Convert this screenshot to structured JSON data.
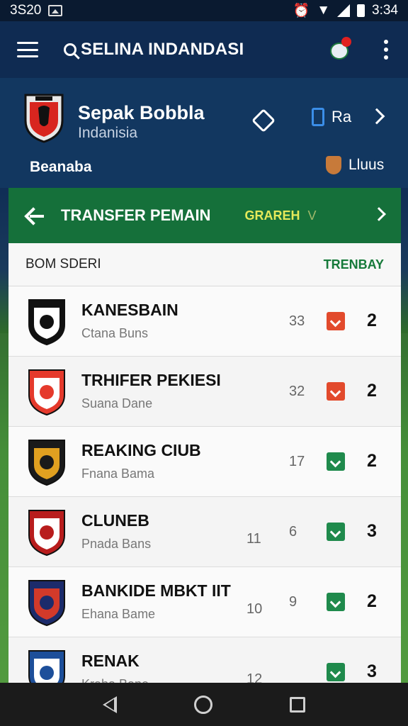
{
  "status_bar": {
    "time_left": "3S20",
    "time_right": "3:34",
    "icons": [
      "image-icon",
      "alarm-icon",
      "wifi-icon",
      "signal-icon",
      "battery-icon"
    ]
  },
  "app_bar": {
    "search_text": "SELINA INDANDASI",
    "icons": [
      "menu-icon",
      "search-icon",
      "globe-icon",
      "more-vert-icon"
    ]
  },
  "league": {
    "title": "Sepak Bobbla",
    "subtitle": "Indanisia",
    "season_label": "Beanaba",
    "lang_label": "Ra",
    "clubs_label": "Lluus"
  },
  "tabs": {
    "transfer": "TRANSFER PEMAIN",
    "grafik": "GRAREH",
    "grafik_suffix": "V"
  },
  "list": {
    "header_left": "BOM SDERI",
    "header_right": "TRENBAY",
    "rows": [
      {
        "title": "KANESBAIN",
        "sub": "Ctana Buns",
        "num1": "",
        "num2": "33",
        "badge": "red",
        "score": "2",
        "crest_colors": [
          "#111111",
          "#ffffff"
        ]
      },
      {
        "title": "TRHIFER PEKIESI",
        "sub": "Suana Dane",
        "num1": "",
        "num2": "32",
        "badge": "red",
        "score": "2",
        "crest_colors": [
          "#e53a2c",
          "#ffffff"
        ]
      },
      {
        "title": "REAKING CIUB",
        "sub": "Fnana Bama",
        "num1": "",
        "num2": "17",
        "badge": "green",
        "score": "2",
        "crest_colors": [
          "#1a1a1a",
          "#e0a020"
        ]
      },
      {
        "title": "CLUNEB",
        "sub": "Pnada Bans",
        "num1": "11",
        "num2": "6",
        "badge": "green",
        "score": "3",
        "crest_colors": [
          "#b81d1d",
          "#ffffff"
        ]
      },
      {
        "title": "BANKIDE MBKT IIT",
        "sub": "Ehana Bame",
        "num1": "10",
        "num2": "9",
        "badge": "green",
        "score": "2",
        "crest_colors": [
          "#1c2b6b",
          "#d33a2a"
        ]
      },
      {
        "title": "RENAK",
        "sub": "Kraha Bane",
        "num1": "12",
        "num2": "",
        "badge": "green",
        "score": "3",
        "crest_colors": [
          "#1d4f9a",
          "#ffffff"
        ]
      }
    ]
  },
  "colors": {
    "app_bar": "#0f2b52",
    "tab_bar": "#15703a",
    "accent_green": "#167a3a",
    "badge_red": "#e24a2c",
    "badge_green": "#1f8a4c"
  }
}
